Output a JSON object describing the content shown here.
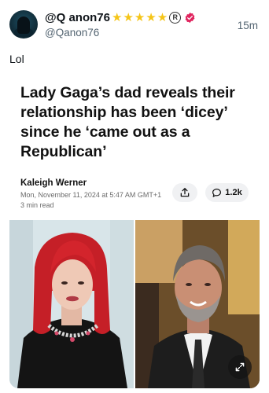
{
  "tweet": {
    "display_name": "@Q anon76",
    "handle": "@Qanon76",
    "time": "15m",
    "stars_count": 5,
    "registered_mark": "R",
    "verified_badge_color": "#e0245e",
    "text": "Lol"
  },
  "card": {
    "headline": "Lady Gaga’s dad reveals their relationship has been ‘dicey’ since he ‘came out as a Republican’",
    "author": "Kaleigh Werner",
    "dateline": "Mon, November 11, 2024 at 5:47 AM GMT+1",
    "read_time": "3 min read",
    "comment_count": "1.2k",
    "share_icon": "share-icon",
    "comment_icon": "comment-icon",
    "expand_icon": "expand-icon"
  },
  "colors": {
    "star": "#f5c518",
    "muted_text": "#536471",
    "pill_bg": "#f0f1f3"
  }
}
